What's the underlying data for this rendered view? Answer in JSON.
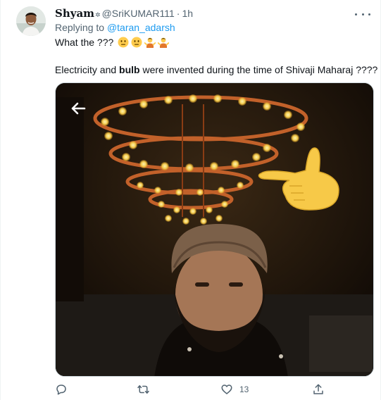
{
  "tweet": {
    "display_name": "Shyam",
    "name_badge": "✲",
    "handle": "@SriKUMAR111",
    "separator": "·",
    "time": "1h",
    "reply_prefix": "Replying to ",
    "reply_handle": "@taran_adarsh",
    "text_line1": "What the ???",
    "text_line2_pre": "Electricity and ",
    "text_line2_bold": "bulb",
    "text_line2_post": " were invented during the time of Shivaji Maharaj ????"
  },
  "actions": {
    "reply_count": "",
    "retweet_count": "",
    "like_count": "13",
    "share_count": ""
  },
  "icons": {
    "more": "more-horizontal-icon",
    "back": "back-arrow-icon",
    "reply": "reply-icon",
    "retweet": "retweet-icon",
    "like": "heart-icon",
    "share": "share-icon"
  },
  "colors": {
    "link": "#1d9bf0",
    "secondary_text": "#536471",
    "primary_text": "#0f1419",
    "border": "#cfd9de"
  }
}
